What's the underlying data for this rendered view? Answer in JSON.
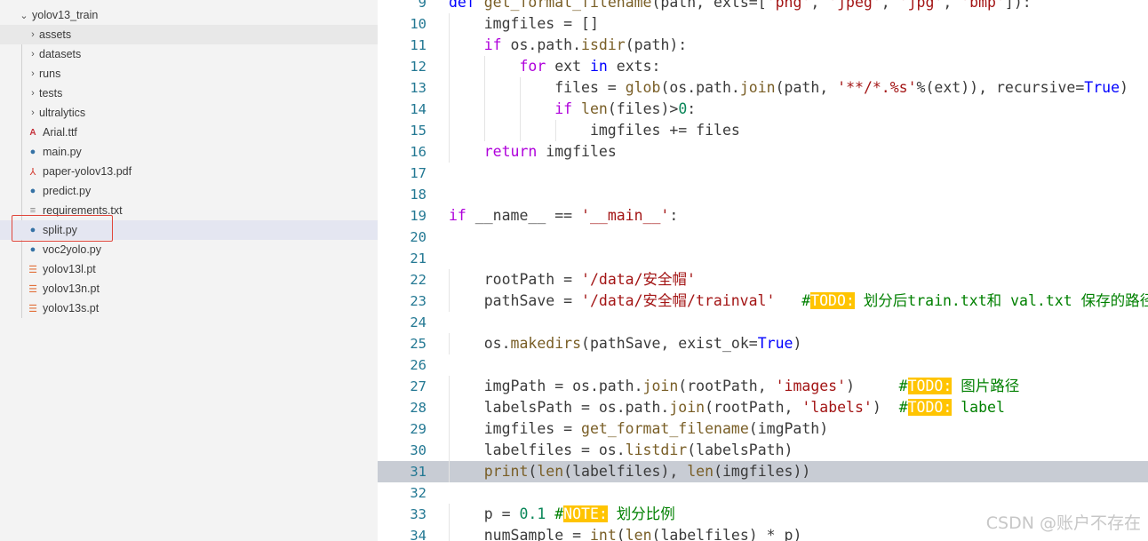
{
  "explorer": {
    "folder_name": "yolov13_train",
    "items": [
      {
        "label": "assets",
        "type": "folder"
      },
      {
        "label": "datasets",
        "type": "folder"
      },
      {
        "label": "runs",
        "type": "folder"
      },
      {
        "label": "tests",
        "type": "folder"
      },
      {
        "label": "ultralytics",
        "type": "folder"
      },
      {
        "label": "Arial.ttf",
        "type": "font"
      },
      {
        "label": "main.py",
        "type": "python"
      },
      {
        "label": "paper-yolov13.pdf",
        "type": "pdf"
      },
      {
        "label": "predict.py",
        "type": "python"
      },
      {
        "label": "requirements.txt",
        "type": "text"
      },
      {
        "label": "split.py",
        "type": "python"
      },
      {
        "label": "voc2yolo.py",
        "type": "python"
      },
      {
        "label": "yolov13l.pt",
        "type": "weights"
      },
      {
        "label": "yolov13n.pt",
        "type": "weights"
      },
      {
        "label": "yolov13s.pt",
        "type": "weights"
      }
    ],
    "selected_item": "split.py",
    "highlight_color": "#e0453a"
  },
  "editor": {
    "current_line": "31",
    "lines": [
      {
        "n": "9",
        "t": "def get_format_filename(path, exts=['png', 'jpeg', 'jpg', 'bmp']):"
      },
      {
        "n": "10",
        "t": "    imgfiles = []"
      },
      {
        "n": "11",
        "t": "    if os.path.isdir(path):"
      },
      {
        "n": "12",
        "t": "        for ext in exts:"
      },
      {
        "n": "13",
        "t": "            files = glob(os.path.join(path, '**/*.%s'%(ext)), recursive=True)"
      },
      {
        "n": "14",
        "t": "            if len(files)>0:"
      },
      {
        "n": "15",
        "t": "                imgfiles += files"
      },
      {
        "n": "16",
        "t": "    return imgfiles"
      },
      {
        "n": "17",
        "t": ""
      },
      {
        "n": "18",
        "t": ""
      },
      {
        "n": "19",
        "t": "if __name__ == '__main__':"
      },
      {
        "n": "20",
        "t": ""
      },
      {
        "n": "21",
        "t": ""
      },
      {
        "n": "22",
        "t": "    rootPath = '/data/安全帽'"
      },
      {
        "n": "23",
        "t": "    pathSave = '/data/安全帽/trainval'   #TODO: 划分后train.txt和 val.txt 保存的路径"
      },
      {
        "n": "24",
        "t": ""
      },
      {
        "n": "25",
        "t": "    os.makedirs(pathSave, exist_ok=True)"
      },
      {
        "n": "26",
        "t": ""
      },
      {
        "n": "27",
        "t": "    imgPath = os.path.join(rootPath, 'images')     #TODO: 图片路径"
      },
      {
        "n": "28",
        "t": "    labelsPath = os.path.join(rootPath, 'labels')  #TODO: label"
      },
      {
        "n": "29",
        "t": "    imgfiles = get_format_filename(imgPath)"
      },
      {
        "n": "30",
        "t": "    labelfiles = os.listdir(labelsPath)"
      },
      {
        "n": "31",
        "t": "    print(len(labelfiles), len(imgfiles))"
      },
      {
        "n": "32",
        "t": ""
      },
      {
        "n": "33",
        "t": "    p = 0.1 #NOTE: 划分比例"
      },
      {
        "n": "34",
        "t": "    numSample = int(len(labelfiles) * p)"
      }
    ]
  },
  "watermark": "CSDN @账户不存在",
  "colors": {
    "keyword": "#0000ff",
    "control": "#af00db",
    "function": "#795e26",
    "string": "#a31515",
    "number": "#098658",
    "comment": "#008000",
    "todo_badge": "#ffc400",
    "line_number": "#237893"
  }
}
